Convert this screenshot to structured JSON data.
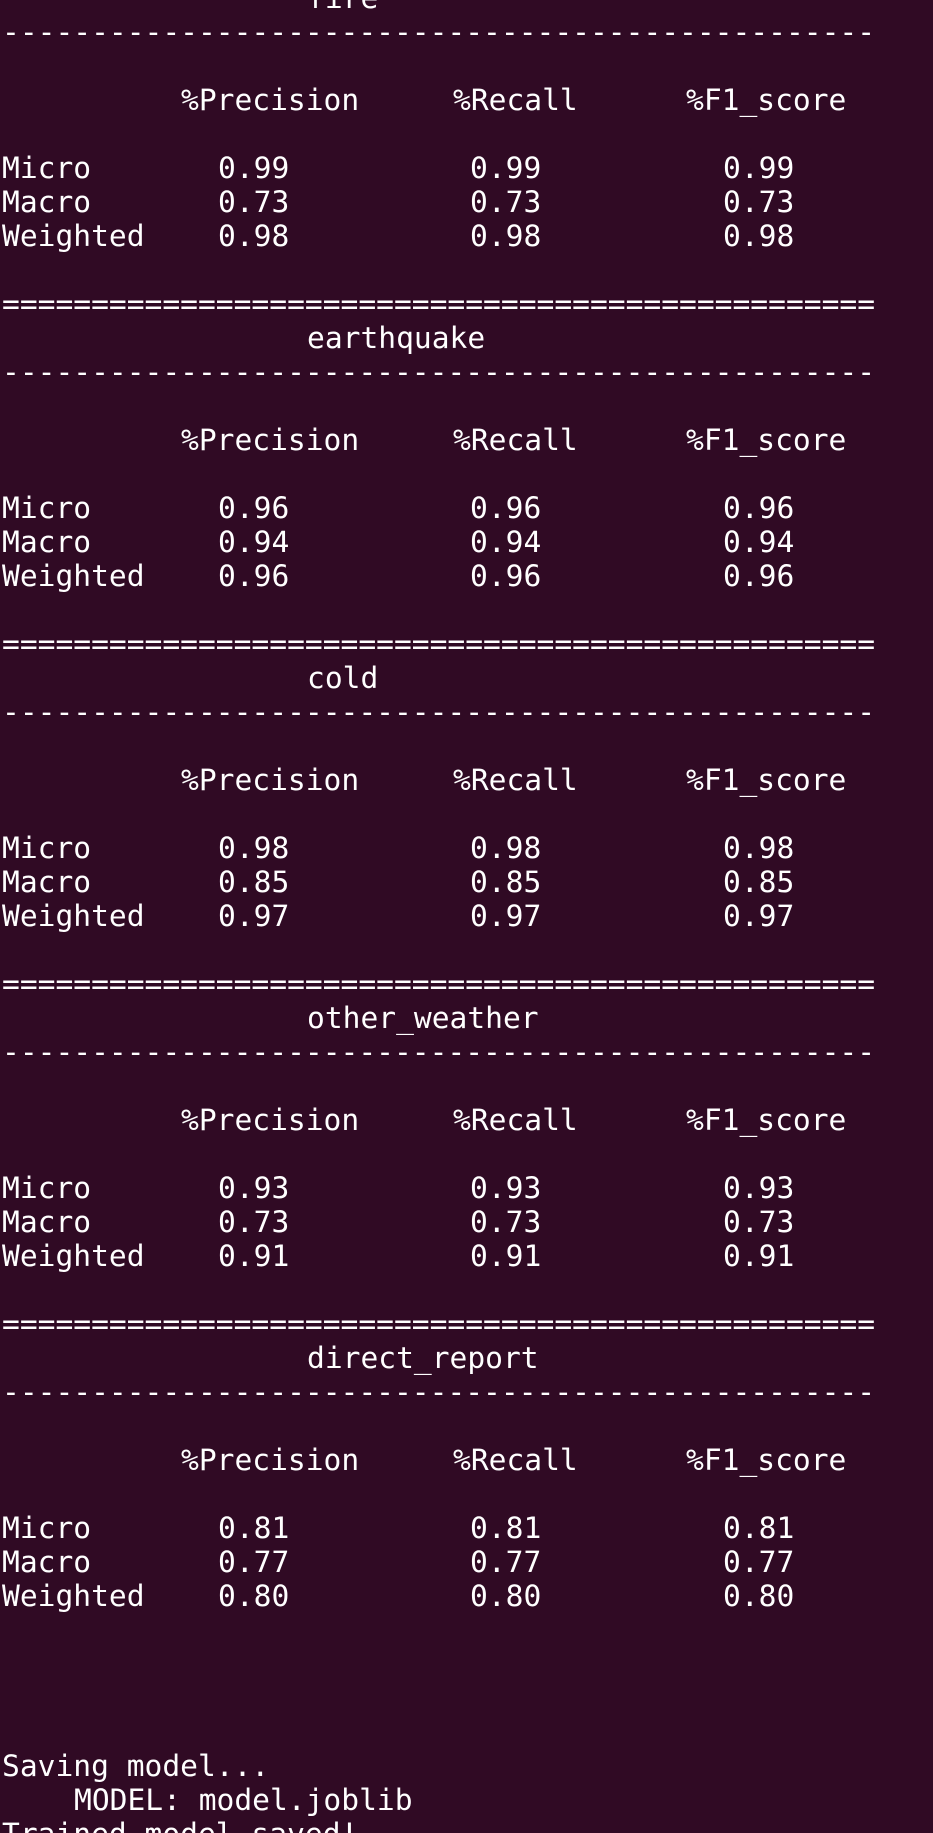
{
  "terminal": {
    "separator_equals": "=================================================",
    "separator_dashes": "-------------------------------------------------",
    "columns": [
      "%Precision",
      "%Recall",
      "%F1_score"
    ],
    "row_labels": [
      "Micro",
      "Macro",
      "Weighted"
    ],
    "sections": [
      {
        "title": "fire",
        "rows": [
          [
            "0.99",
            "0.99",
            "0.99"
          ],
          [
            "0.73",
            "0.73",
            "0.73"
          ],
          [
            "0.98",
            "0.98",
            "0.98"
          ]
        ]
      },
      {
        "title": "earthquake",
        "rows": [
          [
            "0.96",
            "0.96",
            "0.96"
          ],
          [
            "0.94",
            "0.94",
            "0.94"
          ],
          [
            "0.96",
            "0.96",
            "0.96"
          ]
        ]
      },
      {
        "title": "cold",
        "rows": [
          [
            "0.98",
            "0.98",
            "0.98"
          ],
          [
            "0.85",
            "0.85",
            "0.85"
          ],
          [
            "0.97",
            "0.97",
            "0.97"
          ]
        ]
      },
      {
        "title": "other_weather",
        "rows": [
          [
            "0.93",
            "0.93",
            "0.93"
          ],
          [
            "0.73",
            "0.73",
            "0.73"
          ],
          [
            "0.91",
            "0.91",
            "0.91"
          ]
        ]
      },
      {
        "title": "direct_report",
        "rows": [
          [
            "0.81",
            "0.81",
            "0.81"
          ],
          [
            "0.77",
            "0.77",
            "0.77"
          ],
          [
            "0.80",
            "0.80",
            "0.80"
          ]
        ]
      }
    ],
    "footer": {
      "saving": "Saving model...",
      "model_line": "MODEL: model.joblib",
      "saved": "Trained model saved!"
    }
  },
  "colors": {
    "background": "#300a24",
    "text": "#ffffff"
  }
}
